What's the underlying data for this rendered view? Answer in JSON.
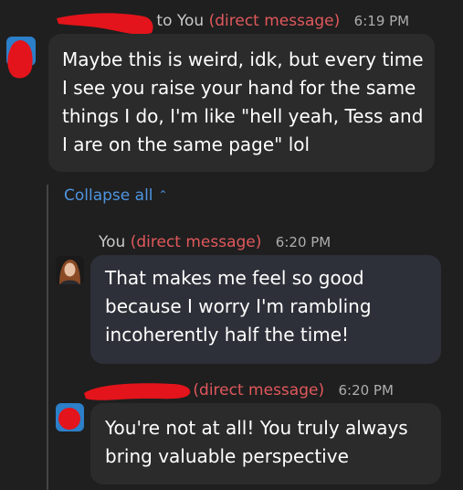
{
  "messages": [
    {
      "sender_suffix": "to You",
      "tag": "(direct message)",
      "time": "6:19 PM",
      "text": "Maybe this is weird, idk, but every time I see you raise your hand for the same things I do, I'm like \"hell yeah, Tess and I are on the same page\" lol"
    },
    {
      "sender": "You",
      "tag": "(direct message)",
      "time": "6:20 PM",
      "text": "That makes me feel so good because I worry I'm rambling incoherently half the time!"
    },
    {
      "tag": "(direct message)",
      "time": "6:20 PM",
      "text": "You're not at all! You truly always bring valuable perspective"
    }
  ],
  "thread": {
    "collapse_label": "Collapse all"
  },
  "colors": {
    "accent_link": "#4f95e0",
    "tag_red": "#e0585c",
    "redaction": "#e3141b"
  }
}
